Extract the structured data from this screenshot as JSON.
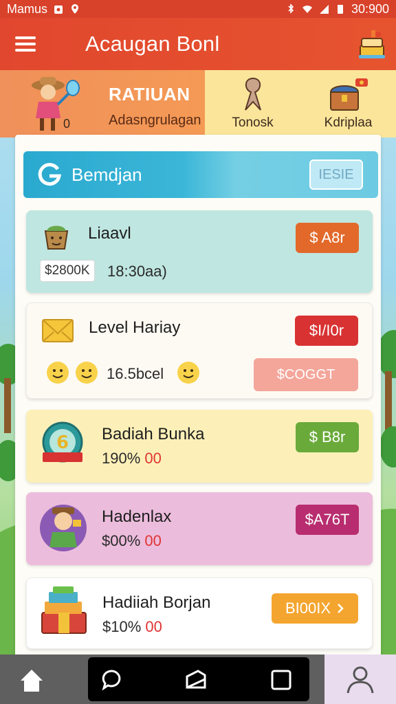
{
  "status_bar": {
    "carrier": "Mamus",
    "time": "30:900"
  },
  "app_bar": {
    "title": "Acaugan Bonl",
    "menu_icon": "hamburger-menu-icon",
    "right_icon": "cake-icon"
  },
  "tabs": {
    "main": {
      "title": "RATIUAN",
      "subtitle": "Adasngrulagan",
      "count": "0"
    },
    "second": {
      "label": "Tonosk"
    },
    "third": {
      "label": "Kdriplaa"
    }
  },
  "search": {
    "label": "Bemdjan",
    "button": "IESIE"
  },
  "cards": [
    {
      "title": "Liaavl",
      "price": "$ A8r",
      "chip": "$2800K",
      "detail": "18:30aa)",
      "color": "#bfe6e0",
      "price_color": "#e2692a"
    },
    {
      "title": "Level Hariay",
      "price": "$I/I0r",
      "detail": "16.5bcel",
      "secondary_button": "$COGGT",
      "color": "#fdfaf3",
      "price_color": "#d83232"
    },
    {
      "title": "Badiah Bunka",
      "price": "$ B8r",
      "detail": "190%",
      "detail_red": "00",
      "color": "#fcf0b8",
      "price_color": "#6aaa3a"
    },
    {
      "title": "Hadenlax",
      "price": "$A76T",
      "detail": "$00%",
      "detail_red": "00",
      "color": "#ecbcdc",
      "price_color": "#b82d6f"
    },
    {
      "title": "Hadiiah Borjan",
      "price": "BI00IX",
      "detail": "$10%",
      "detail_red": "00",
      "color": "#ffffff",
      "price_color": "#f4a52f"
    }
  ],
  "bottom_nav": [
    "home-icon",
    "chat-icon",
    "folder-icon",
    "square-icon",
    "profile-icon"
  ]
}
